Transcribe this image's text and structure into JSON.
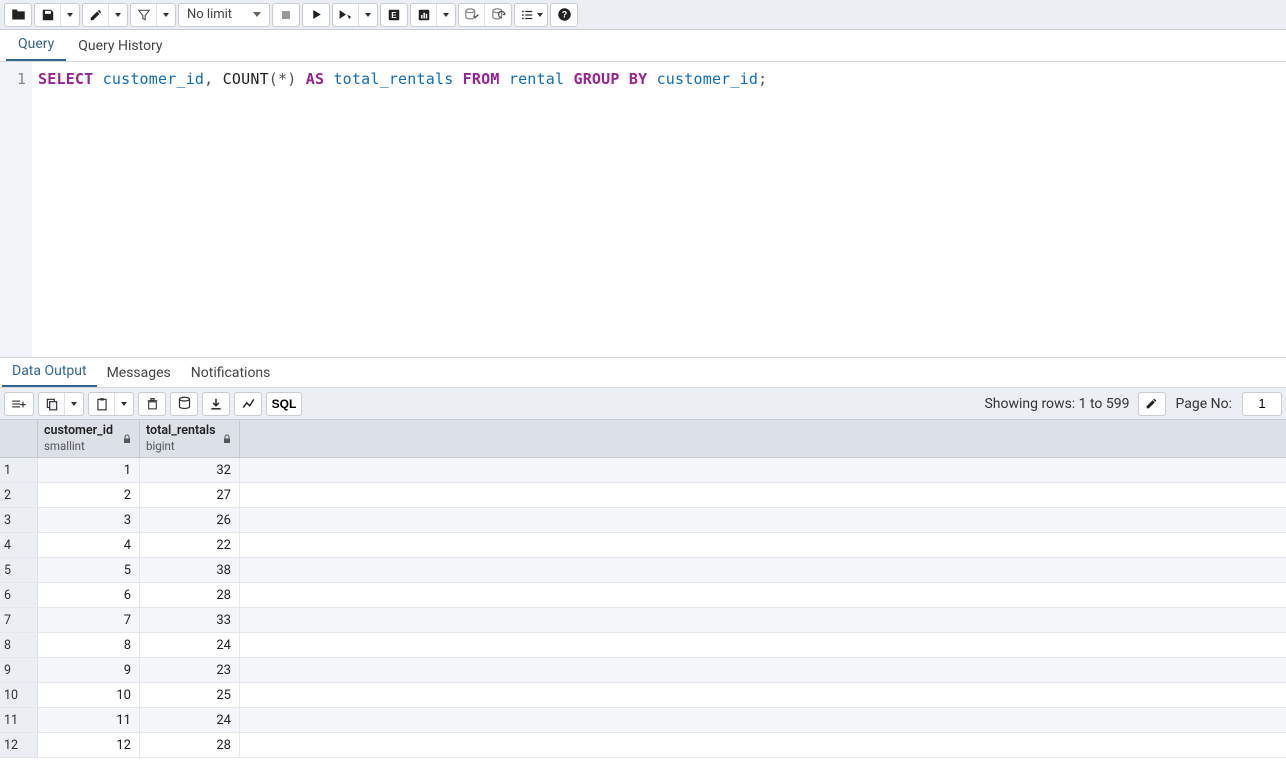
{
  "toolbar": {
    "limit_label": "No limit"
  },
  "editor_tabs": {
    "query": "Query",
    "history": "Query History"
  },
  "code": {
    "line_no": "1",
    "tokens": [
      {
        "t": "SELECT",
        "c": "kw"
      },
      {
        "t": " ",
        "c": ""
      },
      {
        "t": "customer_id",
        "c": "id"
      },
      {
        "t": ", ",
        "c": "punc"
      },
      {
        "t": "COUNT",
        "c": "fn"
      },
      {
        "t": "(*)",
        "c": "punc"
      },
      {
        "t": " ",
        "c": ""
      },
      {
        "t": "AS",
        "c": "kw"
      },
      {
        "t": " ",
        "c": ""
      },
      {
        "t": "total_rentals",
        "c": "id"
      },
      {
        "t": " ",
        "c": ""
      },
      {
        "t": "FROM",
        "c": "kw"
      },
      {
        "t": " ",
        "c": ""
      },
      {
        "t": "rental",
        "c": "id"
      },
      {
        "t": " ",
        "c": ""
      },
      {
        "t": "GROUP",
        "c": "kw"
      },
      {
        "t": " ",
        "c": ""
      },
      {
        "t": "BY",
        "c": "kw"
      },
      {
        "t": " ",
        "c": ""
      },
      {
        "t": "customer_id",
        "c": "id"
      },
      {
        "t": ";",
        "c": "punc"
      }
    ]
  },
  "output_tabs": {
    "data": "Data Output",
    "messages": "Messages",
    "notifications": "Notifications"
  },
  "out_toolbar": {
    "sql_label": "SQL",
    "rows_info": "Showing rows: 1 to 599",
    "page_label": "Page No:",
    "page_value": "1"
  },
  "grid": {
    "columns": [
      {
        "name": "customer_id",
        "type": "smallint"
      },
      {
        "name": "total_rentals",
        "type": "bigint"
      }
    ],
    "rows": [
      {
        "n": "1",
        "a": "1",
        "b": "32"
      },
      {
        "n": "2",
        "a": "2",
        "b": "27"
      },
      {
        "n": "3",
        "a": "3",
        "b": "26"
      },
      {
        "n": "4",
        "a": "4",
        "b": "22"
      },
      {
        "n": "5",
        "a": "5",
        "b": "38"
      },
      {
        "n": "6",
        "a": "6",
        "b": "28"
      },
      {
        "n": "7",
        "a": "7",
        "b": "33"
      },
      {
        "n": "8",
        "a": "8",
        "b": "24"
      },
      {
        "n": "9",
        "a": "9",
        "b": "23"
      },
      {
        "n": "10",
        "a": "10",
        "b": "25"
      },
      {
        "n": "11",
        "a": "11",
        "b": "24"
      },
      {
        "n": "12",
        "a": "12",
        "b": "28"
      }
    ]
  }
}
